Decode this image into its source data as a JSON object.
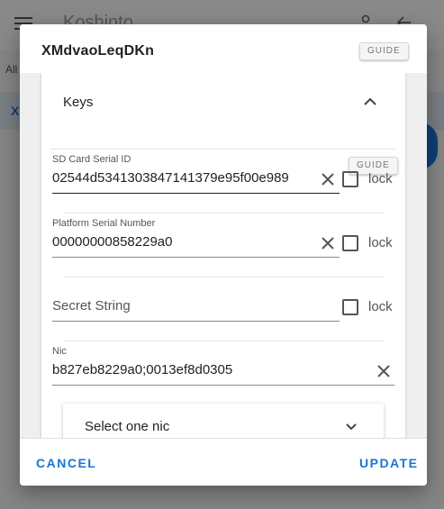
{
  "background": {
    "app_title": "Koshinto",
    "tab_text": "All",
    "row_text": "X"
  },
  "dialog": {
    "title": "XMdvaoLeqDKn",
    "guide_label": "GUIDE",
    "card": {
      "title": "Keys",
      "guide_label": "GUIDE",
      "sd_card": {
        "label": "SD Card Serial ID",
        "value": "02544d5341303847141379e95f00e989",
        "lock_label": "lock"
      },
      "platform_serial": {
        "label": "Platform Serial Number",
        "value": "00000000858229a0",
        "lock_label": "lock"
      },
      "secret_string": {
        "placeholder": "Secret String",
        "lock_label": "lock"
      },
      "nic": {
        "label": "Nic",
        "value": "b827eb8229a0;0013ef8d0305"
      },
      "nic_select": {
        "placeholder": "Select one nic"
      }
    },
    "footer": {
      "cancel_label": "CANCEL",
      "update_label": "UPDATE"
    }
  },
  "colors": {
    "accent": "#1976d2",
    "scrim": "rgba(0,0,0,0.45)"
  },
  "icons": [
    "menu-icon",
    "person-icon",
    "back-arrow-icon",
    "chevron-up-icon",
    "clear-icon",
    "chevron-down-icon"
  ]
}
